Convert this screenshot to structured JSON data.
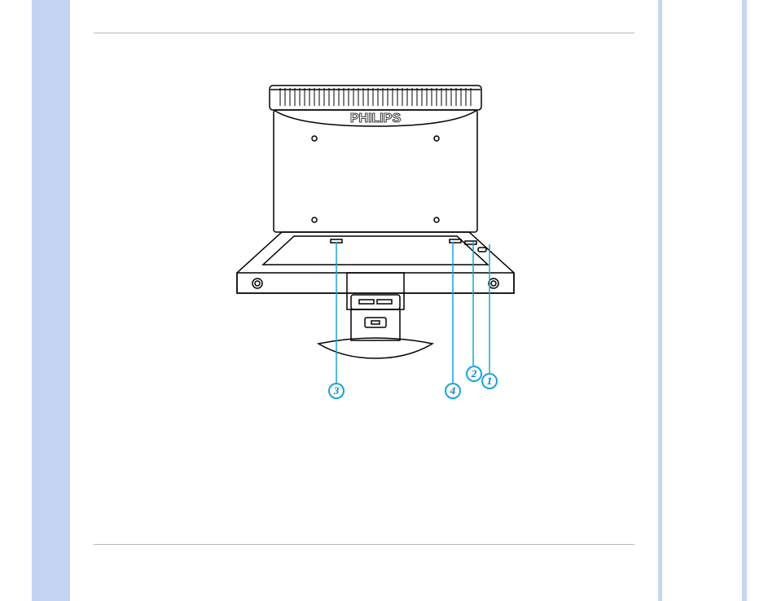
{
  "diagram": {
    "brand": "PHILIPS",
    "callouts": {
      "c1": "1",
      "c2": "2",
      "c3": "3",
      "c4": "4"
    }
  }
}
